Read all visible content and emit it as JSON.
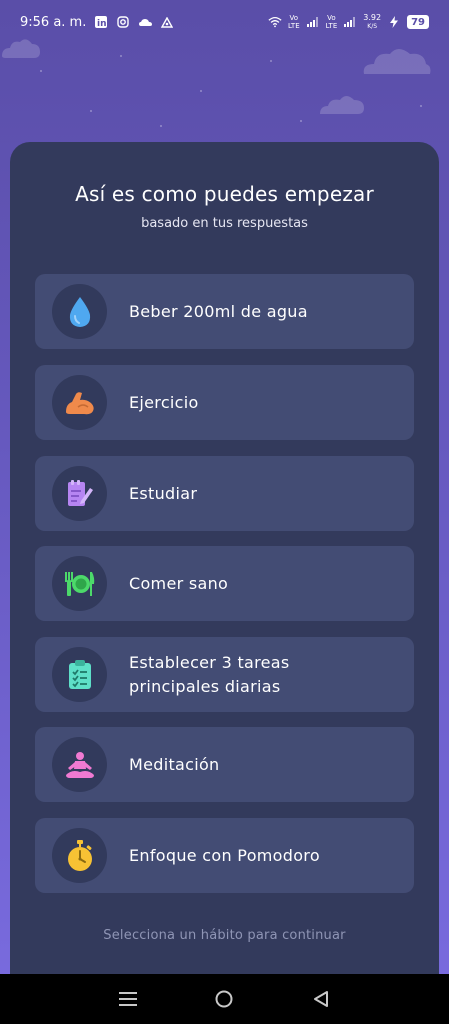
{
  "status_bar": {
    "time": "9:56 a. m.",
    "network_speed": "3.92",
    "network_unit": "K/S",
    "battery": "79",
    "left_icons": [
      "linkedin-icon",
      "instagram-icon",
      "cloud-icon",
      "drive-icon"
    ],
    "right_icons": [
      "wifi-icon",
      "volte-icon",
      "signal-icon",
      "volte-icon",
      "signal-icon",
      "charging-icon"
    ]
  },
  "header": {
    "title": "Así es como puedes empezar",
    "subtitle": "basado en tus respuestas"
  },
  "habits": [
    {
      "label": "Beber 200ml de agua",
      "icon": "water-drop-icon",
      "color": "#4fa8f0"
    },
    {
      "label": "Ejercicio",
      "icon": "flexed-arm-icon",
      "color": "#f08a4b"
    },
    {
      "label": "Estudiar",
      "icon": "note-pencil-icon",
      "color": "#b685f2"
    },
    {
      "label": "Comer sano",
      "icon": "plate-cutlery-icon",
      "color": "#4cd96a"
    },
    {
      "label": "Establecer 3 tareas principales diarias",
      "icon": "clipboard-checklist-icon",
      "color": "#5ee0c8"
    },
    {
      "label": "Meditación",
      "icon": "meditation-icon",
      "color": "#f07ad2"
    },
    {
      "label": "Enfoque con Pomodoro",
      "icon": "stopwatch-icon",
      "color": "#f7c234"
    }
  ],
  "footer": {
    "hint": "Selecciona un hábito para continuar"
  },
  "nav_bar": {
    "buttons": [
      "menu-icon",
      "home-icon",
      "back-icon"
    ]
  }
}
